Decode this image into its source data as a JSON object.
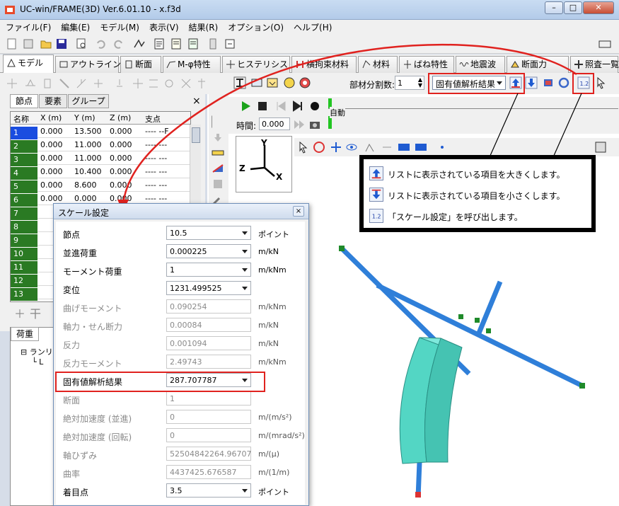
{
  "window": {
    "title": "UC-win/FRAME(3D) Ver.6.01.10 - x.f3d",
    "min": "–",
    "max": "□",
    "close": "✕"
  },
  "menu": [
    "ファイル(F)",
    "編集(E)",
    "モデル(M)",
    "表示(V)",
    "結果(R)",
    "オプション(O)",
    "ヘルプ(H)"
  ],
  "tabs": [
    "モデル",
    "アウトライン",
    "断面",
    "M-φ特性",
    "ヒステリシス",
    "横拘束材料",
    "材料",
    "ばね特性",
    "地震波",
    "断面力",
    "照査一覧"
  ],
  "toolbar2": {
    "division_label": "部材分割数:",
    "division_value": "1",
    "result_select": "固有値解析結果"
  },
  "left_panel": {
    "tabs": [
      "節点",
      "要素",
      "グループ"
    ],
    "close": "×",
    "headers": [
      "名称",
      "X (m)",
      "Y (m)",
      "Z (m)",
      "支点"
    ],
    "rows": [
      [
        "1",
        "0.000",
        "13.500",
        "0.000",
        "---- --F"
      ],
      [
        "2",
        "0.000",
        "11.000",
        "0.000",
        "---- ---"
      ],
      [
        "3",
        "0.000",
        "11.000",
        "0.000",
        "---- ---"
      ],
      [
        "4",
        "0.000",
        "10.400",
        "0.000",
        "---- ---"
      ],
      [
        "5",
        "0.000",
        "8.600",
        "0.000",
        "---- ---"
      ],
      [
        "6",
        "0.000",
        "0.000",
        "0.000",
        "---- ---"
      ],
      [
        "7",
        "",
        "",
        "",
        ""
      ],
      [
        "8",
        "",
        "",
        "",
        ""
      ],
      [
        "9",
        "",
        "",
        "",
        ""
      ],
      [
        "10",
        "",
        "",
        "",
        ""
      ],
      [
        "11",
        "",
        "",
        "",
        ""
      ],
      [
        "12",
        "",
        "",
        "",
        ""
      ],
      [
        "13",
        "",
        "",
        "",
        ""
      ]
    ],
    "bottom_tab": "荷重",
    "tree": [
      "ランリ",
      "L"
    ]
  },
  "anim": {
    "time_label": "時間:",
    "time_value": "0.000",
    "auto": "自動"
  },
  "axes": {
    "y": "Y",
    "z": "Z",
    "x": "X"
  },
  "dialog": {
    "title": "スケール設定",
    "close": "×",
    "fields": [
      {
        "label": "節点",
        "value": "10.5",
        "unit": "ポイント",
        "enabled": true,
        "drop": true
      },
      {
        "label": "並進荷重",
        "value": "0.000225",
        "unit": "m/kN",
        "enabled": true,
        "drop": true
      },
      {
        "label": "モーメント荷重",
        "value": "1",
        "unit": "m/kNm",
        "enabled": true,
        "drop": true
      },
      {
        "label": "変位",
        "value": "1231.499525",
        "unit": "",
        "enabled": true,
        "drop": true
      },
      {
        "label": "曲げモーメント",
        "value": "0.090254",
        "unit": "m/kNm",
        "enabled": false,
        "drop": false
      },
      {
        "label": "軸力・せん断力",
        "value": "0.00084",
        "unit": "m/kN",
        "enabled": false,
        "drop": false
      },
      {
        "label": "反力",
        "value": "0.001094",
        "unit": "m/kN",
        "enabled": false,
        "drop": false
      },
      {
        "label": "反力モーメント",
        "value": "2.49743",
        "unit": "m/kNm",
        "enabled": false,
        "drop": false
      },
      {
        "label": "固有値解析結果",
        "value": "287.707787",
        "unit": "",
        "enabled": true,
        "drop": true
      },
      {
        "label": "断面",
        "value": "1",
        "unit": "",
        "enabled": false,
        "drop": false
      },
      {
        "label": "絶対加速度 (並進)",
        "value": "0",
        "unit": "m/(m/s²)",
        "enabled": false,
        "drop": false
      },
      {
        "label": "絶対加速度 (回転)",
        "value": "0",
        "unit": "m/(mrad/s²)",
        "enabled": false,
        "drop": false
      },
      {
        "label": "軸ひずみ",
        "value": "52504842264.96707",
        "unit": "m/(μ)",
        "enabled": false,
        "drop": false
      },
      {
        "label": "曲率",
        "value": "4437425.676587",
        "unit": "m/(1/m)",
        "enabled": false,
        "drop": false
      },
      {
        "label": "着目点",
        "value": "3.5",
        "unit": "ポイント",
        "enabled": true,
        "drop": true
      }
    ]
  },
  "callout": {
    "lines": [
      {
        "icon": "scale-up-icon",
        "text": "リストに表示されている項目を大きくします。"
      },
      {
        "icon": "scale-down-icon",
        "text": "リストに表示されている項目を小さくします。"
      },
      {
        "icon": "scale-settings-icon",
        "text": "「スケール設定」を呼び出します。"
      }
    ],
    "icon3_text": "1.2"
  },
  "colors": {
    "accent_red": "#e0221f",
    "node_green": "#2a7a23",
    "selected_blue": "#1a4de0",
    "member_blue": "#2f7fd9",
    "solid_teal": "#53d6c4"
  }
}
